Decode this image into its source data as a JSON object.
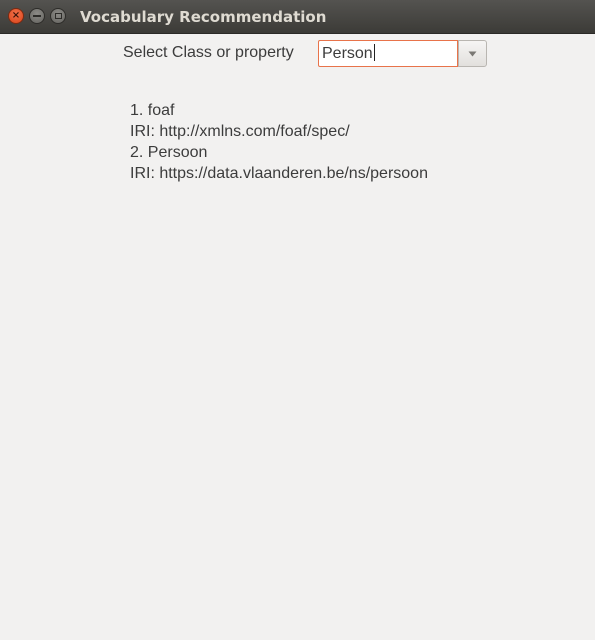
{
  "window": {
    "title": "Vocabulary Recommendation",
    "close_glyph": "×"
  },
  "selector": {
    "label": "Select Class or property",
    "value": "Person"
  },
  "results": [
    {
      "name": "1. foaf",
      "iri": "IRI: http://xmlns.com/foaf/spec/"
    },
    {
      "name": "2. Persoon",
      "iri": "IRI: https://data.vlaanderen.be/ns/persoon"
    }
  ]
}
